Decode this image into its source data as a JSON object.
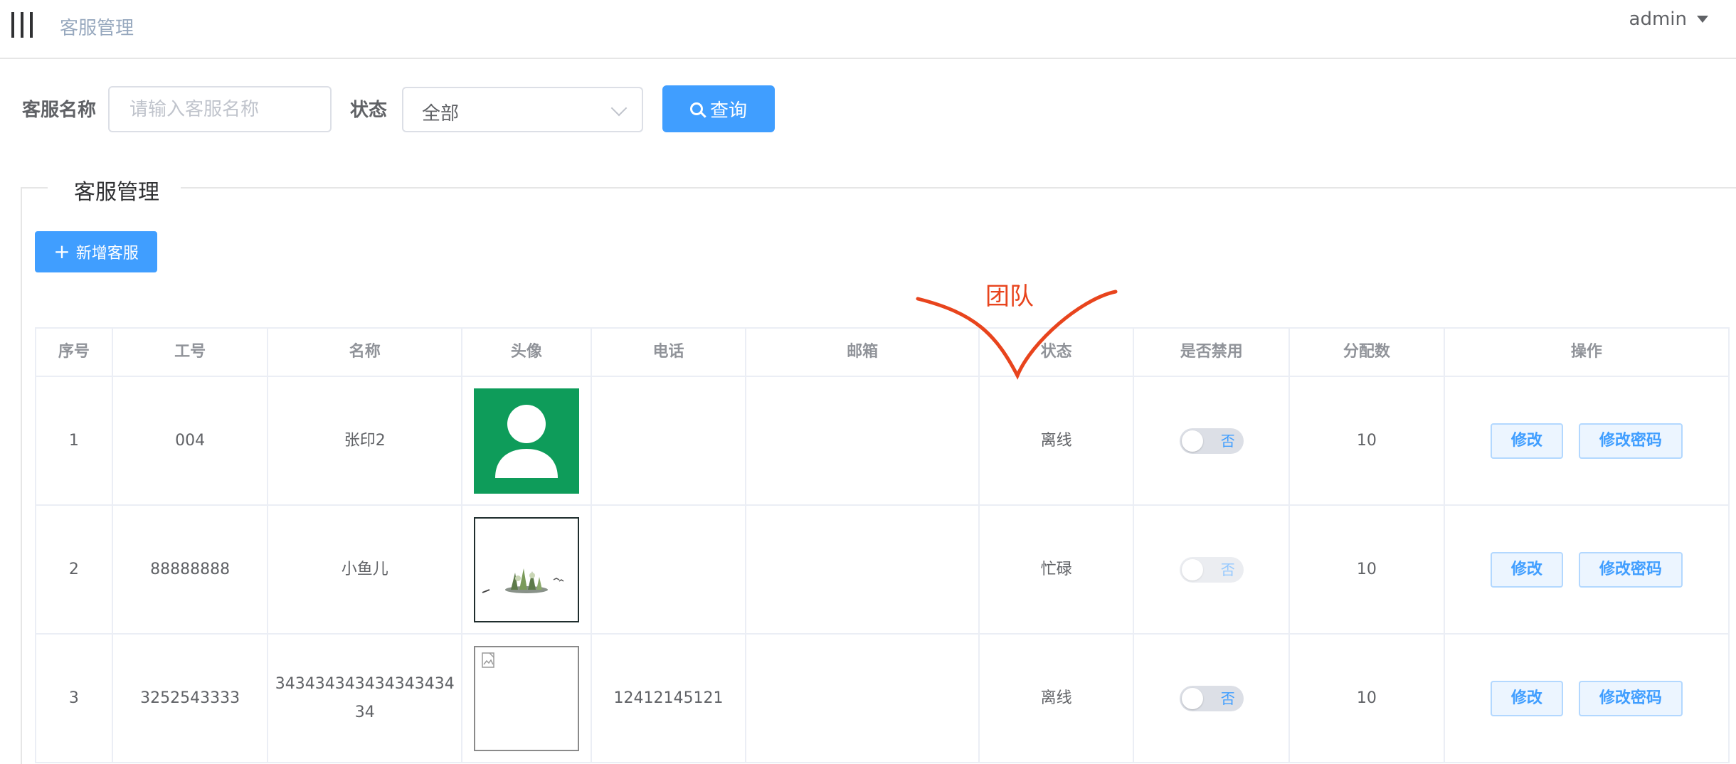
{
  "header": {
    "breadcrumb": "客服管理",
    "user": "admin"
  },
  "search": {
    "name_label": "客服名称",
    "name_placeholder": "请输入客服名称",
    "name_value": "",
    "status_label": "状态",
    "status_value": "全部",
    "query_button": "查询"
  },
  "panel": {
    "legend": "客服管理",
    "add_button": "新增客服"
  },
  "table": {
    "columns": [
      "序号",
      "工号",
      "名称",
      "头像",
      "电话",
      "邮箱",
      "状态",
      "是否禁用",
      "分配数",
      "操作"
    ],
    "rows": [
      {
        "index": "1",
        "job_no": "004",
        "name": "张印2",
        "phone": "",
        "email": "",
        "status": "离线",
        "disabled_text": "否",
        "assigned": "10",
        "switch_enabled": true
      },
      {
        "index": "2",
        "job_no": "88888888",
        "name": "小鱼儿",
        "phone": "",
        "email": "",
        "status": "忙碌",
        "disabled_text": "否",
        "assigned": "10",
        "switch_enabled": false
      },
      {
        "index": "3",
        "job_no": "3252543333",
        "name": "34343434343434343434",
        "phone": "12412145121",
        "email": "",
        "status": "离线",
        "disabled_text": "否",
        "assigned": "10",
        "switch_enabled": true
      }
    ],
    "edit_button": "修改",
    "password_button": "修改密码"
  },
  "annotation": {
    "text": "团队",
    "color": "#e8441d"
  },
  "colors": {
    "primary": "#409eff",
    "avatar_green": "#0e9c5a"
  }
}
